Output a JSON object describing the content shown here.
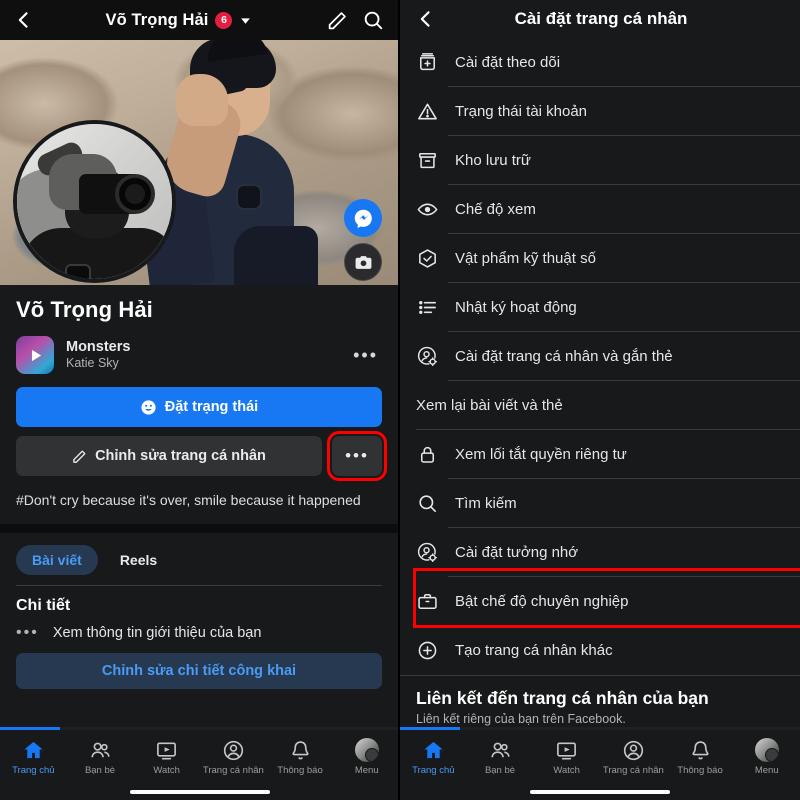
{
  "left": {
    "topbar": {
      "back_icon": "chevron-left-icon",
      "title": "Võ Trọng Hải",
      "badge": "6",
      "dropdown_icon": "chevron-down-icon",
      "edit_icon": "pencil-icon",
      "search_icon": "search-icon"
    },
    "cover": {
      "message_icon": "messenger-icon",
      "camera_icon": "camera-icon",
      "avatar_camera_icon": "camera-icon"
    },
    "profile": {
      "name": "Võ Trọng Hải"
    },
    "music": {
      "title": "Monsters",
      "artist": "Katie Sky",
      "play_icon": "play-icon",
      "more": "•••"
    },
    "buttons": {
      "status_icon": "smiley-icon",
      "status_label": "Đặt trạng thái",
      "edit_icon": "pencil-icon",
      "edit_label": "Chỉnh sửa trang cá nhân",
      "more_label": "•••"
    },
    "bio": "#Don't cry because it's over, smile because it happened",
    "tabs": [
      {
        "label": "Bài viết",
        "active": true
      },
      {
        "label": "Reels",
        "active": false
      }
    ],
    "details": {
      "section_title": "Chi tiết",
      "dots": "•••",
      "row_label": "Xem thông tin giới thiệu của bạn",
      "public_button": "Chỉnh sửa chi tiết công khai"
    }
  },
  "right": {
    "topbar": {
      "back_icon": "chevron-left-icon",
      "title": "Cài đặt trang cá nhân"
    },
    "menu": [
      {
        "label": "Cài đặt theo dõi",
        "icon": "follow-settings-icon",
        "highlighted": false
      },
      {
        "label": "Trạng thái tài khoản",
        "icon": "warning-triangle-icon",
        "highlighted": false
      },
      {
        "label": "Kho lưu trữ",
        "icon": "archive-icon",
        "highlighted": false
      },
      {
        "label": "Chế độ xem",
        "icon": "eye-icon",
        "highlighted": false
      },
      {
        "label": "Vật phẩm kỹ thuật số",
        "icon": "hexagon-check-icon",
        "highlighted": false
      },
      {
        "label": "Nhật ký hoạt động",
        "icon": "list-icon",
        "highlighted": false
      },
      {
        "label": "Cài đặt trang cá nhân và gắn thẻ",
        "icon": "person-gear-icon",
        "highlighted": false
      },
      {
        "label": "Xem lại bài viết và thẻ",
        "icon": "none",
        "highlighted": false
      },
      {
        "label": "Xem lối tắt quyền riêng tư",
        "icon": "lock-icon",
        "highlighted": false
      },
      {
        "label": "Tìm kiếm",
        "icon": "search-icon",
        "highlighted": false
      },
      {
        "label": "Cài đặt tưởng nhớ",
        "icon": "person-gear-icon",
        "highlighted": false
      },
      {
        "label": "Bật chế độ chuyên nghiệp",
        "icon": "briefcase-icon",
        "highlighted": true
      },
      {
        "label": "Tạo trang cá nhân khác",
        "icon": "plus-circle-icon",
        "highlighted": false
      }
    ],
    "footer": {
      "title": "Liên kết đến trang cá nhân của bạn",
      "subtitle": "Liên kết riêng của bạn trên Facebook."
    }
  },
  "bottom_nav": [
    {
      "label": "Trang chủ",
      "icon": "home-icon",
      "active": true
    },
    {
      "label": "Bạn bè",
      "icon": "friends-icon",
      "active": false
    },
    {
      "label": "Watch",
      "icon": "watch-icon",
      "active": false
    },
    {
      "label": "Trang cá nhân",
      "icon": "profile-icon",
      "active": false
    },
    {
      "label": "Thông báo",
      "icon": "bell-icon",
      "active": false
    },
    {
      "label": "Menu",
      "icon": "menu-avatar-icon",
      "active": false
    }
  ],
  "colors": {
    "accent": "#1877f2",
    "accent_light": "#4a9bf5",
    "badge": "#e41e3f",
    "highlight": "#ff0000",
    "bg": "#18191a",
    "surface": "#303234"
  }
}
